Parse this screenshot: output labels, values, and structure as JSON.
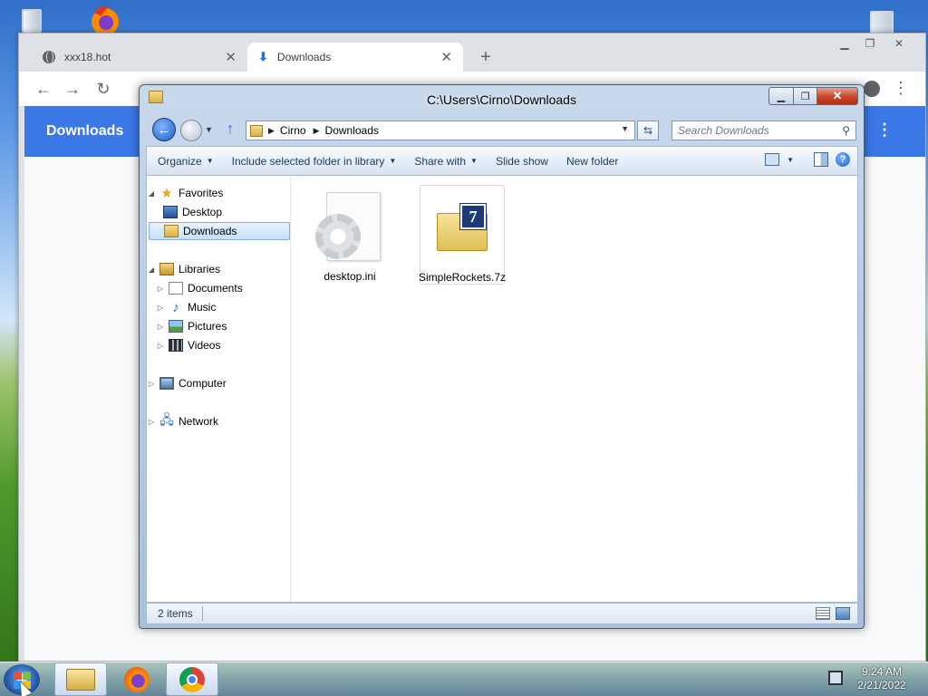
{
  "desktop": {
    "icons": [
      {
        "name": "recycle-bin-icon"
      },
      {
        "name": "firefox-icon"
      },
      {
        "name": "recycle-bin-icon"
      }
    ]
  },
  "chrome": {
    "tabs": [
      {
        "title": "xxx18.hot",
        "icon": "globe-icon"
      },
      {
        "title": "Downloads",
        "icon": "download-icon"
      }
    ],
    "downloads_header": "Downloads",
    "icons": {
      "back": "←",
      "forward": "→",
      "reload": "↻",
      "menu": "⋮",
      "close": "✕",
      "new_tab": "+"
    }
  },
  "explorer": {
    "title": "C:\\Users\\Cirno\\Downloads",
    "address": {
      "crumbs": [
        "Cirno",
        "Downloads"
      ]
    },
    "search": {
      "placeholder": "Search Downloads"
    },
    "commands": [
      "Organize",
      "Include selected folder in library",
      "Share with",
      "Slide show",
      "New folder"
    ],
    "nav": {
      "favorites": {
        "label": "Favorites",
        "items": [
          "Desktop",
          "Downloads"
        ]
      },
      "libraries": {
        "label": "Libraries",
        "items": [
          "Documents",
          "Music",
          "Pictures",
          "Videos"
        ]
      },
      "computer": "Computer",
      "network": "Network"
    },
    "files": [
      {
        "name": "desktop.ini",
        "icon": "settings-file-icon"
      },
      {
        "name": "SimpleRockets.7z",
        "icon": "7zip-archive-icon"
      }
    ],
    "status": "2 items",
    "accent": "#1e395b"
  },
  "taskbar": {
    "apps": [
      {
        "name": "Windows Explorer",
        "icon": "explorer-folder-icon"
      },
      {
        "name": "Firefox",
        "icon": "firefox-icon"
      },
      {
        "name": "Google Chrome",
        "icon": "chrome-icon"
      }
    ],
    "clock": {
      "time": "9:24 AM",
      "date": "2/21/2022"
    }
  }
}
